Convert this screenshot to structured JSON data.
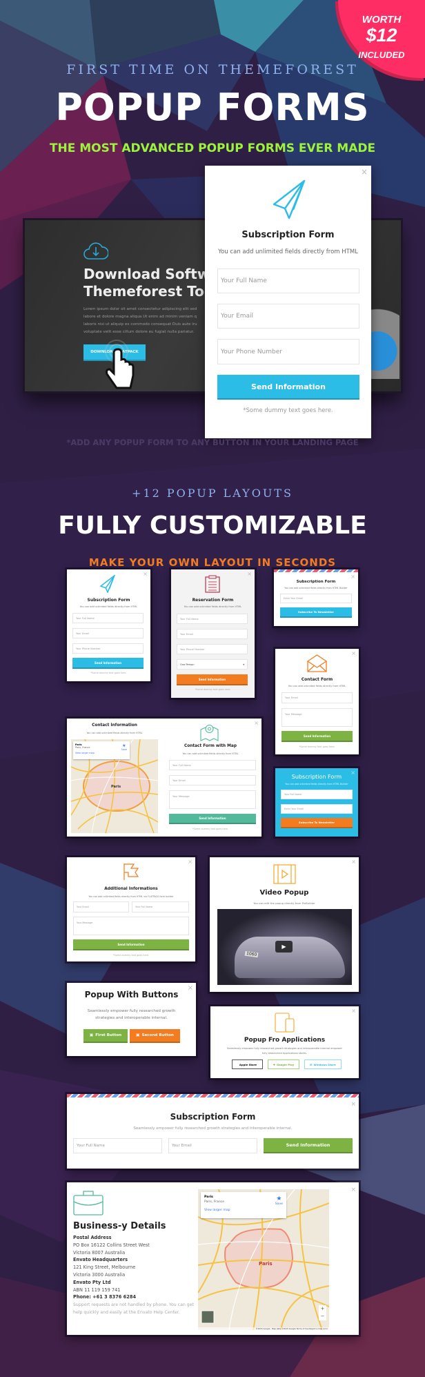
{
  "badge": {
    "line1": "WORTH",
    "price": "$12",
    "line2": "INCLUDED"
  },
  "hero": {
    "kicker": "FIRST TIME ON THEMEFOREST",
    "title": "POPUP FORMS",
    "tagline": "THE MOST ADVANCED POPUP FORMS EVER MADE"
  },
  "demo": {
    "landing": {
      "title_line1": "Download Softwar",
      "title_line2": "Themeforest Toda",
      "body": "Lorem ipsum dolor sit amet consectetur adipiscing elit sed labore et dolore magna aliqua Ut enim ad minim veniam q laboris nisi ut aliquip ex commodo consequat Duis aute iru voluptate velit esse cillum dolore eu fugiat nulla pariatur.",
      "button": "DOWNLOAD FLATPACK"
    },
    "popup": {
      "title": "Subscription Form",
      "subtitle": "You can add unlimited fields directly from HTML",
      "fields": [
        "Your Full Name",
        "Your Email",
        "Your Phone Number"
      ],
      "button": "Send Information",
      "note": "*Some dummy text goes here.",
      "close": "×"
    }
  },
  "note": "*ADD ANY POPUP FORM TO ANY BUTTON IN YOUR LANDING PAGE",
  "section2": {
    "kicker": "+12 POPUP LAYOUTS",
    "title": "FULLY CUSTOMIZABLE",
    "tagline": "MAKE YOUR OWN LAYOUT IN SECONDS"
  },
  "cards": {
    "subscription": {
      "title": "Subscription Form",
      "subtitle": "You can add unlimited fields directly from HTML",
      "fields": [
        "Your Full Name",
        "Your Email",
        "Your Phone Number"
      ],
      "button": "Send Information",
      "note": "*Some dummy text goes here."
    },
    "reservation": {
      "title": "Reservation Form",
      "subtitle": "You can add unlimited fields directly from HTML",
      "fields": [
        "Your Full Name",
        "Your Email",
        "Your Phone Number"
      ],
      "select": "One Person",
      "button": "Send Information",
      "note": "*Some dummy text goes here."
    },
    "newsletter": {
      "title": "Subscription Form",
      "subtitle": "You can add unlimited fields directly from HTML Builder",
      "field": "Enter Your Email",
      "button": "Subscribe To Newsletter"
    },
    "contact": {
      "title": "Contact Form",
      "subtitle": "You can add unlimited fields directly from HTML",
      "fields": [
        "Your Email",
        "Your Message"
      ],
      "button": "Send Information",
      "note": "*Some dummy text goes here."
    },
    "contact_map": {
      "left_title": "Contact Information",
      "left_subtitle": "You can add unlimited fields directly from HTML",
      "map_place": "Paris",
      "map_region": "Paris, France",
      "map_link": "View larger map",
      "map_save": "Save",
      "map_city": "Paris",
      "title": "Contact Form with Map",
      "subtitle": "You can add unlimited fields directly from HTML",
      "fields": [
        "Your Full Name",
        "Your Email",
        "Your Message"
      ],
      "button": "Send Information",
      "note": "*Some dummy text goes here."
    },
    "blue_subscription": {
      "title": "Subscription Form",
      "subtitle": "You can add unlimited fields directly from HTML Builder",
      "fields": [
        "Your Full Name",
        "Enter Your Email"
      ],
      "button": "Subscribe To Newsletter"
    },
    "additional": {
      "title": "Additional Informations",
      "subtitle": "You can add unlimited fields directly from HTML via FLATPACK form builder",
      "fields": [
        "Your Email",
        "Your Full Name",
        "Your Message"
      ],
      "button": "Send Information",
      "note": "*Some dummy text goes here."
    },
    "video": {
      "title": "Video Popup",
      "subtitle": "You can edit the popup directly from PixBuilder",
      "plate": "1060"
    },
    "buttons": {
      "title": "Popup With Buttons",
      "subtitle": "Seamlessly empower fully researched growth strategies and interoperable internal.",
      "button1": "First Button",
      "button2": "Second Button"
    },
    "apps": {
      "title": "Popup Fro Applications",
      "subtitle": "Seamlessly empower fully researched growth strategies and interoperable internal empower fully researched Applications stores.",
      "stores": [
        "Apple Store",
        "Google Play",
        "Windows Store"
      ]
    },
    "wide_subscription": {
      "title": "Subscription Form",
      "subtitle": "Seamlessly empower fully researched growth strategies and interoperable internal.",
      "fields": [
        "Your Full Name",
        "Your Email"
      ],
      "button": "Send Information"
    },
    "business": {
      "title": "Business-y Details",
      "lines": [
        {
          "text": "Postal Address",
          "bold": true
        },
        {
          "text": "PO Box 16122 Collins Street West"
        },
        {
          "text": "Victoria 8007 Australia"
        },
        {
          "text": "Envato Headquarters",
          "bold": true
        },
        {
          "text": "121 King Street, Melbourne"
        },
        {
          "text": "Victoria 3000 Australia"
        },
        {
          "text": "Envato Pty Ltd",
          "bold": true
        },
        {
          "text": "ABN 11 119 159 741"
        },
        {
          "text": "Phone: +61 3 8376 6284",
          "bold": true
        }
      ],
      "support": "Support requests are not handled by phone. You can get help quickly and easily at the Envato Help Center.",
      "map_place": "Paris",
      "map_region": "Paris, France",
      "map_link": "View larger map",
      "map_save": "Save",
      "map_city": "Paris",
      "map_credit": "©2015 Google · Map data ©2015 Google   Terms of Use   Report a map error"
    }
  },
  "colors": {
    "background": "#2f1f45",
    "badge": "#fe2d63",
    "hero_tagline": "#9df33c",
    "kicker": "#8fb2ee",
    "orange": "#f47c20",
    "blue": "#2cbde6",
    "green": "#7cb342",
    "teal": "#52b99a"
  }
}
